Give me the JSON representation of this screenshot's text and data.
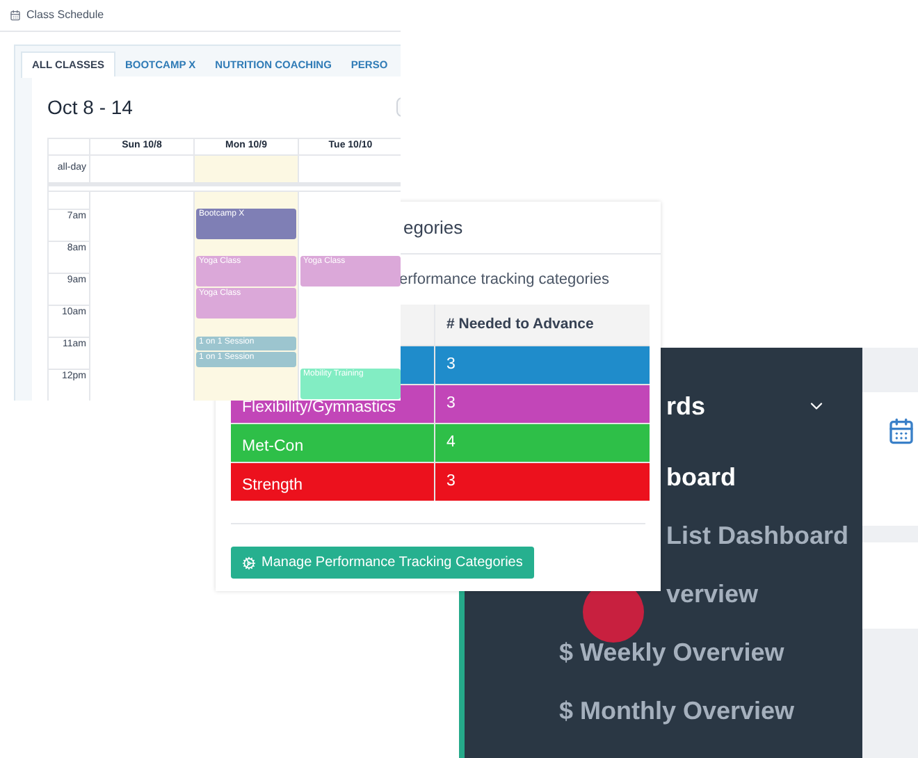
{
  "calendar_window": {
    "title": "Class Schedule",
    "tabs": [
      {
        "label": "ALL CLASSES",
        "selected": true
      },
      {
        "label": "BOOTCAMP X",
        "selected": false
      },
      {
        "label": "NUTRITION COACHING",
        "selected": false
      },
      {
        "label": "PERSO",
        "selected": false
      }
    ],
    "range": "Oct 8 - 14",
    "all_day_label": "all-day",
    "hours": [
      "7am",
      "8am",
      "9am",
      "10am",
      "11am",
      "12pm"
    ],
    "days": [
      {
        "label": "Sun 10/8",
        "today": false
      },
      {
        "label": "Mon 10/9",
        "today": true,
        "slots": [
          {
            "kind": "half-gap"
          },
          {
            "kind": "hour-event",
            "title": "Bootcamp X",
            "color": "#7f7fb5"
          },
          {
            "kind": "half-gap"
          },
          {
            "kind": "hour-event",
            "title": "Yoga Class",
            "color": "#dba8d9"
          },
          {
            "kind": "hour-event",
            "title": "Yoga Class",
            "color": "#dba8d9"
          },
          {
            "kind": "half-gap"
          },
          {
            "kind": "half-event",
            "title": "1 on 1 Session",
            "color": "#9cc5cf"
          },
          {
            "kind": "half-event",
            "title": "1 on 1 Session",
            "color": "#9cc5cf"
          }
        ]
      },
      {
        "label": "Tue 10/10",
        "today": false,
        "slots": [
          {
            "kind": "half-gap"
          },
          {
            "kind": "hour-gap"
          },
          {
            "kind": "half-gap"
          },
          {
            "kind": "hour-event",
            "title": "Yoga Class",
            "color": "#dba8d9"
          },
          {
            "kind": "hour-gap"
          },
          {
            "kind": "hour-gap"
          },
          {
            "kind": "half-gap"
          },
          {
            "kind": "hour-event",
            "title": "Mobility Training",
            "color": "#82edc3"
          }
        ]
      }
    ]
  },
  "categories_panel": {
    "heading": "egories",
    "description": "erformance tracking categories",
    "column_2_header": "# Needed to Advance",
    "rows": [
      {
        "needed": "3",
        "color": "#1f8ccb"
      },
      {
        "name": "Flexibility/Gymnastics",
        "needed": "3",
        "color": "#c246b8"
      },
      {
        "name": "Met-Con",
        "needed": "4",
        "color": "#2ebf48"
      },
      {
        "name": "Strength",
        "needed": "3",
        "color": "#ec111d"
      }
    ],
    "button": "Manage Performance Tracking Categories"
  },
  "dashboard_menu": {
    "section": {
      "label": "rds",
      "expanded": true
    },
    "items": [
      {
        "label": "board",
        "selected": true,
        "partial": true
      },
      {
        "label": "List Dashboard",
        "selected": false,
        "partial": true
      },
      {
        "label": "verview",
        "selected": false,
        "partial": true
      },
      {
        "label": "$ Weekly Overview",
        "selected": false,
        "partial": false
      },
      {
        "label": "$ Monthly Overview",
        "selected": false,
        "partial": false
      }
    ]
  }
}
